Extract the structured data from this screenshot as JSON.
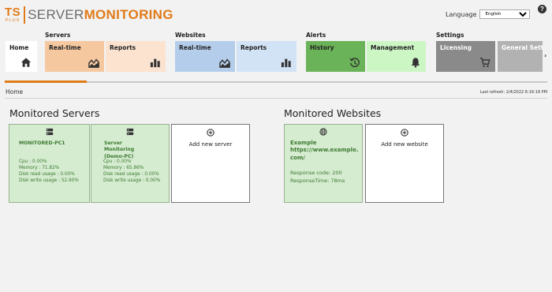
{
  "app": {
    "logo_ts": "TS",
    "logo_plus": "PLUS",
    "logo_server": "SERVER",
    "logo_monitoring": "MONITORING",
    "help_icon": "?"
  },
  "language": {
    "label": "Language",
    "selected": "English"
  },
  "nav": {
    "home": {
      "label": "Home",
      "icon": "home-icon"
    },
    "groups": [
      {
        "title": "Servers",
        "tiles": [
          {
            "label": "Real-time",
            "icon": "realtime-chart-icon",
            "color": "#f6c8a0"
          },
          {
            "label": "Reports",
            "icon": "bar-chart-icon",
            "color": "#fbe3d0"
          }
        ]
      },
      {
        "title": "Websites",
        "tiles": [
          {
            "label": "Real-time",
            "icon": "realtime-chart-icon",
            "color": "#b4cdeb"
          },
          {
            "label": "Reports",
            "icon": "bar-chart-icon",
            "color": "#d3e3f6"
          }
        ]
      },
      {
        "title": "Alerts",
        "tiles": [
          {
            "label": "History",
            "icon": "history-icon",
            "color": "#6bb358"
          },
          {
            "label": "Management",
            "icon": "bell-icon",
            "color": "#cdf6c5"
          }
        ]
      },
      {
        "title": "Settings",
        "tiles": [
          {
            "label": "Licensing",
            "icon": "cart-icon",
            "color": "#8a8a8a"
          },
          {
            "label": "General Settings",
            "icon": "gear-icon",
            "color": "#b2b2b2"
          }
        ]
      }
    ],
    "scroll_arrow": "›"
  },
  "breadcrumb": "Home",
  "last_refresh": "Last refresh: 2/4/2022 6:16:19 PM",
  "servers": {
    "title": "Monitored Servers",
    "cards": [
      {
        "name": "MONITORED-PC1",
        "cpu": "Cpu : 0.00%",
        "memory": "Memory : 71.82%",
        "disk_read": "Disk read usage : 0.00%",
        "disk_write": "Disk write usage : 52.90%"
      },
      {
        "name": "Server Monitoring (Demo-PC)",
        "cpu": "Cpu : 0.00%",
        "memory": "Memory : 65.86%",
        "disk_read": "Disk read usage : 0.00%",
        "disk_write": "Disk write usage : 0.00%"
      }
    ],
    "add_label": "Add new server"
  },
  "websites": {
    "title": "Monitored Websites",
    "cards": [
      {
        "name": "Example",
        "url": "https://www.example.com/",
        "response_code": "Response code: 200",
        "response_time": "ResponseTime: 78ms"
      }
    ],
    "add_label": "Add new website"
  },
  "colors": {
    "accent": "#e07b1a",
    "ok_text": "#3e7a32",
    "ok_bg": "#d5ecd0"
  }
}
